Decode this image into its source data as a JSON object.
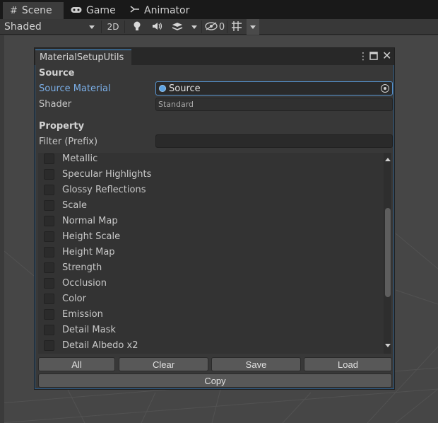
{
  "tabs": [
    {
      "label": "Scene",
      "icon": "grid-icon",
      "active": true
    },
    {
      "label": "Game",
      "icon": "gamepad-icon",
      "active": false
    },
    {
      "label": "Animator",
      "icon": "animator-icon",
      "active": false
    }
  ],
  "toolbar": {
    "shading_mode": "Shaded",
    "toggle_2d": "2D",
    "hidden_count": "0"
  },
  "window": {
    "title": "MaterialSetupUtils",
    "source_section": "Source",
    "source_material_label": "Source Material",
    "source_material_value": "Source",
    "shader_label": "Shader",
    "shader_value": "Standard",
    "property_section": "Property",
    "filter_label": "Filter (Prefix)",
    "filter_value": "",
    "properties": [
      {
        "label": "Metallic",
        "checked": false
      },
      {
        "label": "Specular Highlights",
        "checked": false
      },
      {
        "label": "Glossy Reflections",
        "checked": false
      },
      {
        "label": "Scale",
        "checked": false
      },
      {
        "label": "Normal Map",
        "checked": false
      },
      {
        "label": "Height Scale",
        "checked": false
      },
      {
        "label": "Height Map",
        "checked": false
      },
      {
        "label": "Strength",
        "checked": false
      },
      {
        "label": "Occlusion",
        "checked": false
      },
      {
        "label": "Color",
        "checked": false
      },
      {
        "label": "Emission",
        "checked": false
      },
      {
        "label": "Detail Mask",
        "checked": false
      },
      {
        "label": "Detail Albedo x2",
        "checked": false
      }
    ],
    "buttons": {
      "all": "All",
      "clear": "Clear",
      "save": "Save",
      "load": "Load",
      "copy": "Copy"
    }
  },
  "colors": {
    "accent": "#5795d3",
    "label_blue": "#7bafe8"
  }
}
